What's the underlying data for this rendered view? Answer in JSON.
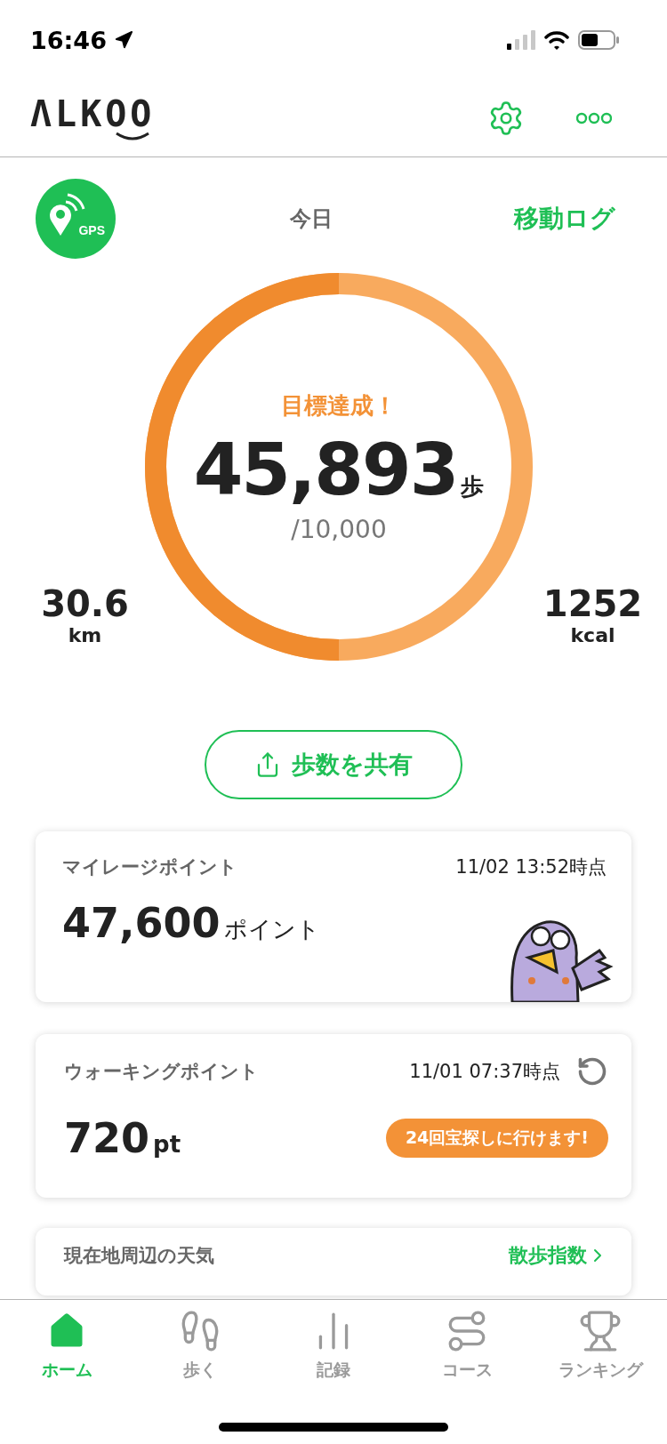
{
  "status_bar": {
    "time": "16:46"
  },
  "header": {
    "logo": "ΛLKOO"
  },
  "today": {
    "gps_label": "GPS",
    "day": "今日",
    "log_link": "移動ログ",
    "goal_message": "目標達成！",
    "steps": "45,893",
    "steps_unit": "歩",
    "goal": "/10,000",
    "distance": {
      "value": "30.6",
      "unit": "km"
    },
    "calories": {
      "value": "1252",
      "unit": "kcal"
    }
  },
  "share_button": "歩数を共有",
  "mileage_card": {
    "title": "マイレージポイント",
    "timestamp": "11/02 13:52時点",
    "value": "47,600",
    "unit": "ポイント"
  },
  "walking_card": {
    "title": "ウォーキングポイント",
    "timestamp": "11/01 07:37時点",
    "value": "720",
    "unit": "pt",
    "badge": "24回宝探しに行けます!"
  },
  "weather_card": {
    "title": "現在地周辺の天気",
    "link": "散歩指数"
  },
  "tab_bar": [
    {
      "kind": "home",
      "label": "ホーム",
      "selected": true
    },
    {
      "kind": "walk",
      "label": "歩く",
      "selected": false
    },
    {
      "kind": "record",
      "label": "記録",
      "selected": false
    },
    {
      "kind": "course",
      "label": "コース",
      "selected": false
    },
    {
      "kind": "ranking",
      "label": "ランキング",
      "selected": false
    }
  ]
}
